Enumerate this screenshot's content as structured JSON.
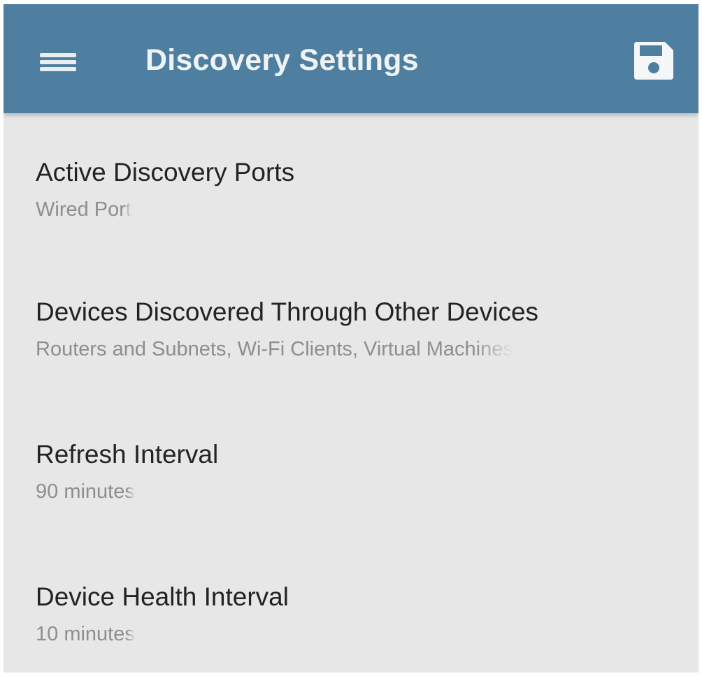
{
  "colors": {
    "appbar": "#4f7fa0",
    "background": "#e7e7e7",
    "title_text": "#f0f3f5",
    "item_title": "#232323",
    "item_subtitle": "#8e8e8e"
  },
  "appbar": {
    "menu_icon": "hamburger-menu-icon",
    "title": "Discovery Settings",
    "save_icon": "floppy-disk-save-icon"
  },
  "settings": [
    {
      "title": "Active Discovery Ports",
      "subtitle": "Wired Port"
    },
    {
      "title": "Devices Discovered Through Other Devices",
      "subtitle": "Routers and Subnets, Wi-Fi Clients, Virtual Machines"
    },
    {
      "title": "Refresh Interval",
      "subtitle": "90 minutes"
    },
    {
      "title": "Device Health Interval",
      "subtitle": "10 minutes"
    }
  ]
}
